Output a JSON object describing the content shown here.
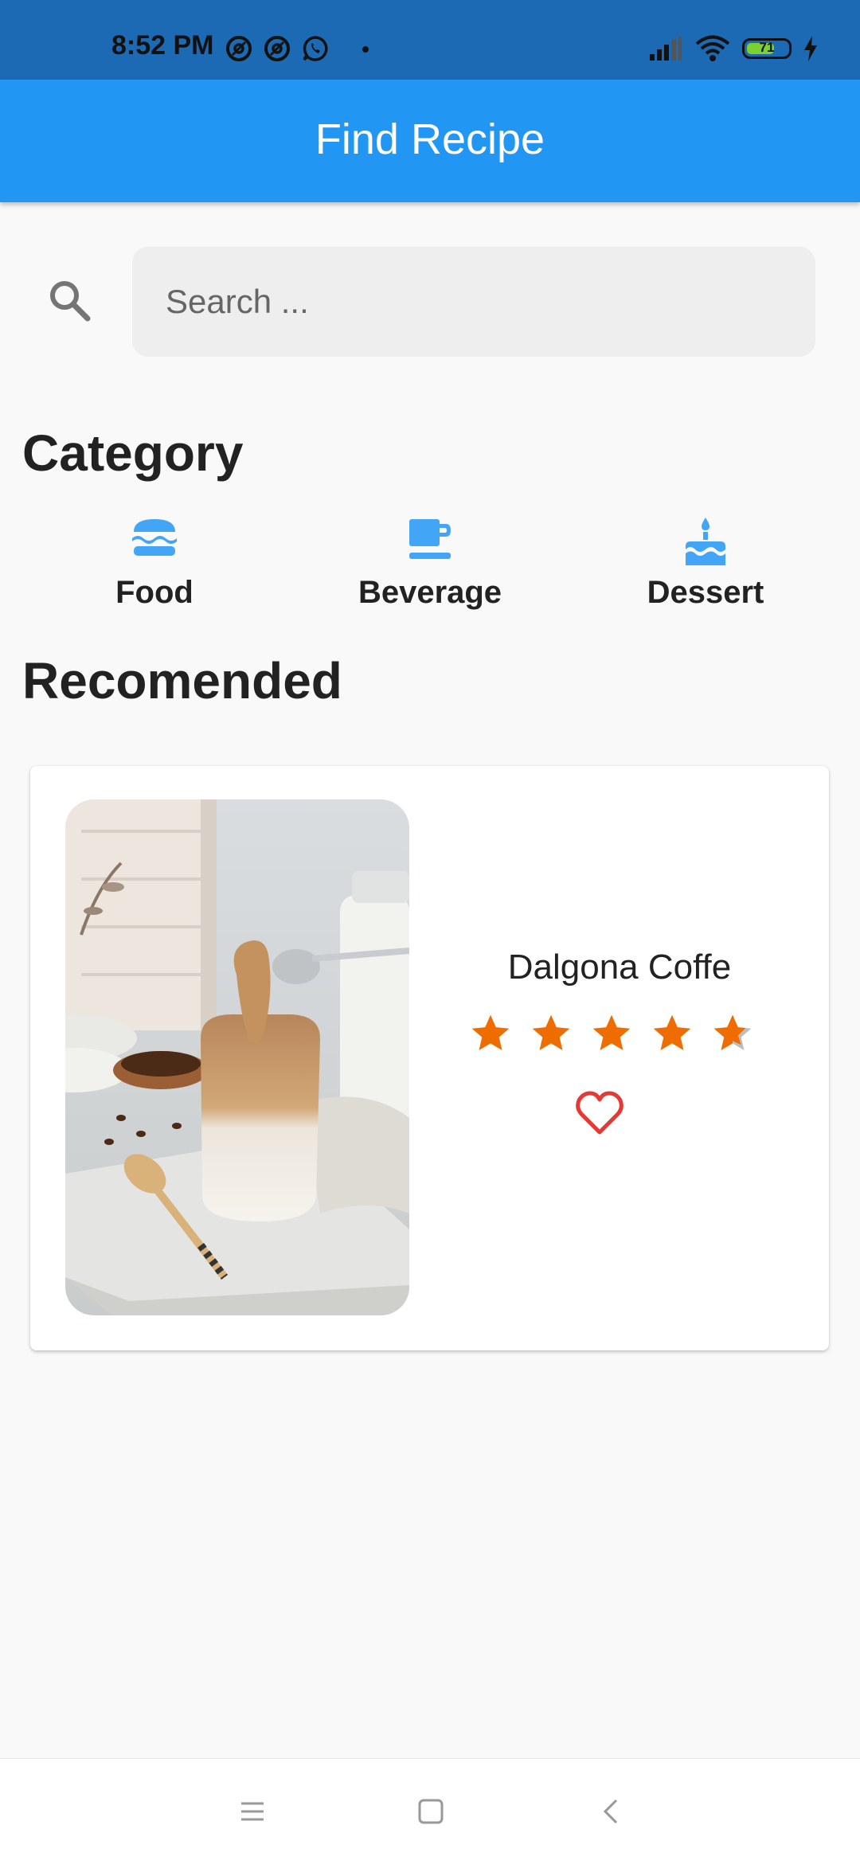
{
  "status_bar": {
    "time": "8:52 PM",
    "battery": "71",
    "icons": [
      "at-icon",
      "at-icon",
      "whatsapp-icon",
      "dot-icon",
      "signal-icon",
      "wifi-icon",
      "battery-icon",
      "charging-icon"
    ]
  },
  "app_bar": {
    "title": "Find Recipe"
  },
  "search": {
    "placeholder": "Search ...",
    "value": "",
    "icon": "search-icon"
  },
  "category": {
    "title": "Category",
    "items": [
      {
        "label": "Food",
        "icon": "burger-icon"
      },
      {
        "label": "Beverage",
        "icon": "coffee-cup-icon"
      },
      {
        "label": "Dessert",
        "icon": "cake-icon"
      }
    ]
  },
  "recommended": {
    "title": "Recomended",
    "items": [
      {
        "name": "Dalgona Coffe",
        "rating": 4.5,
        "rating_max": 5,
        "favorite": false,
        "image": "dalgona-coffee-photo"
      }
    ]
  },
  "nav_bar": {
    "buttons": [
      "menu-icon",
      "home-icon",
      "back-icon"
    ]
  },
  "colors": {
    "status_bar": "#1c6ab4",
    "app_bar": "#2196f3",
    "category_icon": "#42a5f5",
    "star": "#ef6c00",
    "heart": "#e53935",
    "background": "#f9f9f9"
  }
}
